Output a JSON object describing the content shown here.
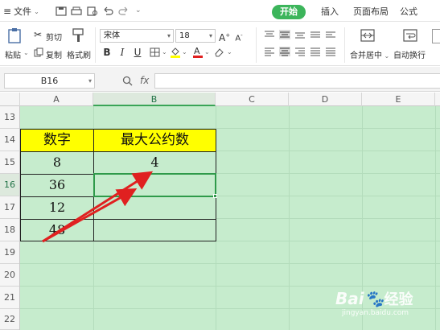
{
  "app": {
    "menu_file": "文件",
    "tabs": [
      "开始",
      "插入",
      "页面布局",
      "公式"
    ]
  },
  "ribbon": {
    "paste": "粘贴",
    "cut": "剪切",
    "copy": "复制",
    "format_painter": "格式刷",
    "font_name": "宋体",
    "font_size": "18",
    "merge_center": "合并居中",
    "auto_wrap": "自动换行"
  },
  "formula_bar": {
    "name_box": "B16",
    "fx": "fx",
    "formula": ""
  },
  "columns": [
    "A",
    "B",
    "C",
    "D",
    "E"
  ],
  "rows": [
    "13",
    "14",
    "15",
    "16",
    "17",
    "18",
    "19",
    "20",
    "21",
    "22"
  ],
  "sheet": {
    "header_a": "数字",
    "header_b": "最大公约数",
    "a15": "8",
    "a16": "36",
    "a17": "12",
    "a18": "48",
    "b15": "4",
    "b16": "",
    "b17": "",
    "b18": ""
  },
  "colors": {
    "accent": "#3cb55b",
    "header_fill": "#ffff00",
    "sheet_bg": "#c6eccd",
    "arrow": "#e02020"
  },
  "watermark": {
    "brand": "Bai",
    "brand_cn": "经验",
    "url": "jingyan.baidu.com"
  }
}
